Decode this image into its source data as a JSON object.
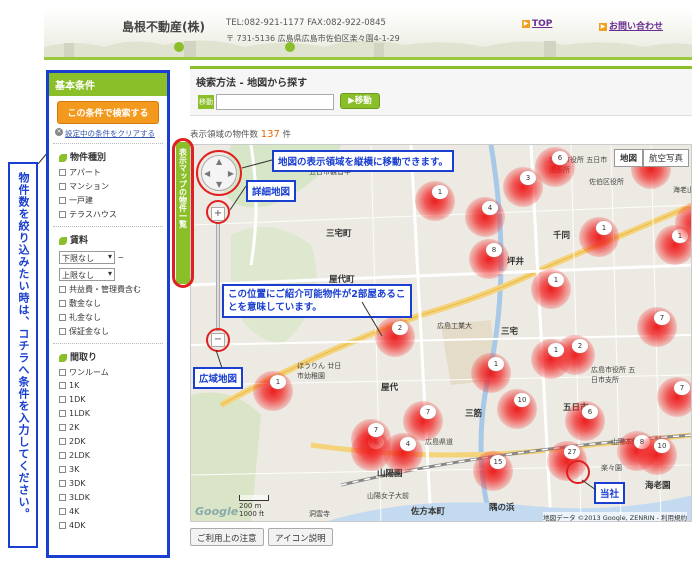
{
  "header": {
    "company": "島根不動産(株)",
    "tel": "TEL:082-921-1177 FAX:082-922-0845",
    "address": "〒 731-5136 広島県広島市佐伯区楽々園4-1-29",
    "top_link": "TOP",
    "contact_link": "お問い合わせ"
  },
  "sidebar": {
    "title": "基本条件",
    "search_button": "この条件で検索する",
    "clear_link": "設定中の条件をクリアする",
    "type_section": "物件種別",
    "types": [
      "アパート",
      "マンション",
      "一戸建",
      "テラスハウス"
    ],
    "rent_section": "賃料",
    "rent_min": "下限なし",
    "rent_tilde": "~",
    "rent_max": "上限なし",
    "rent_options": [
      "共益費・管理費含む",
      "敷金なし",
      "礼金なし",
      "保証金なし"
    ],
    "layout_section": "間取り",
    "layouts": [
      "ワンルーム",
      "1K",
      "1DK",
      "1LDK",
      "2K",
      "2DK",
      "2LDK",
      "3K",
      "3DK",
      "3LDK",
      "4K",
      "4DK"
    ]
  },
  "left_note": "物件数を絞り込みたい時は、コチラへ条件を入力してください。",
  "main": {
    "title": "検索方法 - 地図から探す",
    "move_button": "移動",
    "search_placeholder": "",
    "count_prefix": "表示領域の物件数",
    "count_value": "137",
    "count_suffix": "件",
    "side_tab": "表示マップの物件一覧"
  },
  "map": {
    "type_map": "地図",
    "type_satellite": "航空写真",
    "scale_m": "200 m",
    "scale_ft": "1000 ft",
    "copyright": "地図データ ©2013 Google, ZENRIN - 利用規約",
    "labels": [
      "三宅町",
      "坪井",
      "屋代町",
      "広島工業大",
      "三宅",
      "ほうりん 廿日市幼稚園",
      "屋代",
      "三筋",
      "山陽本線",
      "山陽園",
      "千同",
      "五日市",
      "海老園",
      "楽々園",
      "佐方本町",
      "隅の浜",
      "広島県道",
      "洞雲寺",
      "山陽女子大前",
      "広島市役所 五日市出張所",
      "五日市観音中",
      "広島市役所 五日市支所",
      "佐伯区役所",
      "海老山"
    ],
    "pins": [
      "1",
      "6",
      "3",
      "1",
      "4",
      "1",
      "8",
      "1",
      "1",
      "1",
      "2",
      "7",
      "2",
      "1",
      "7",
      "10",
      "7",
      "6",
      "4",
      "15",
      "8",
      "6",
      "10",
      "7",
      "1",
      "1",
      "27"
    ]
  },
  "callouts": {
    "pan": "地図の表示領域を縦横に移動できます。",
    "detail": "詳細地図",
    "wide": "広域地図",
    "note": "この位置にご紹介可能物件が2部屋あることを意味しています。",
    "our_office": "当社"
  },
  "buttons": {
    "usage": "ご利用上の注意",
    "icon_help": "アイコン説明"
  }
}
